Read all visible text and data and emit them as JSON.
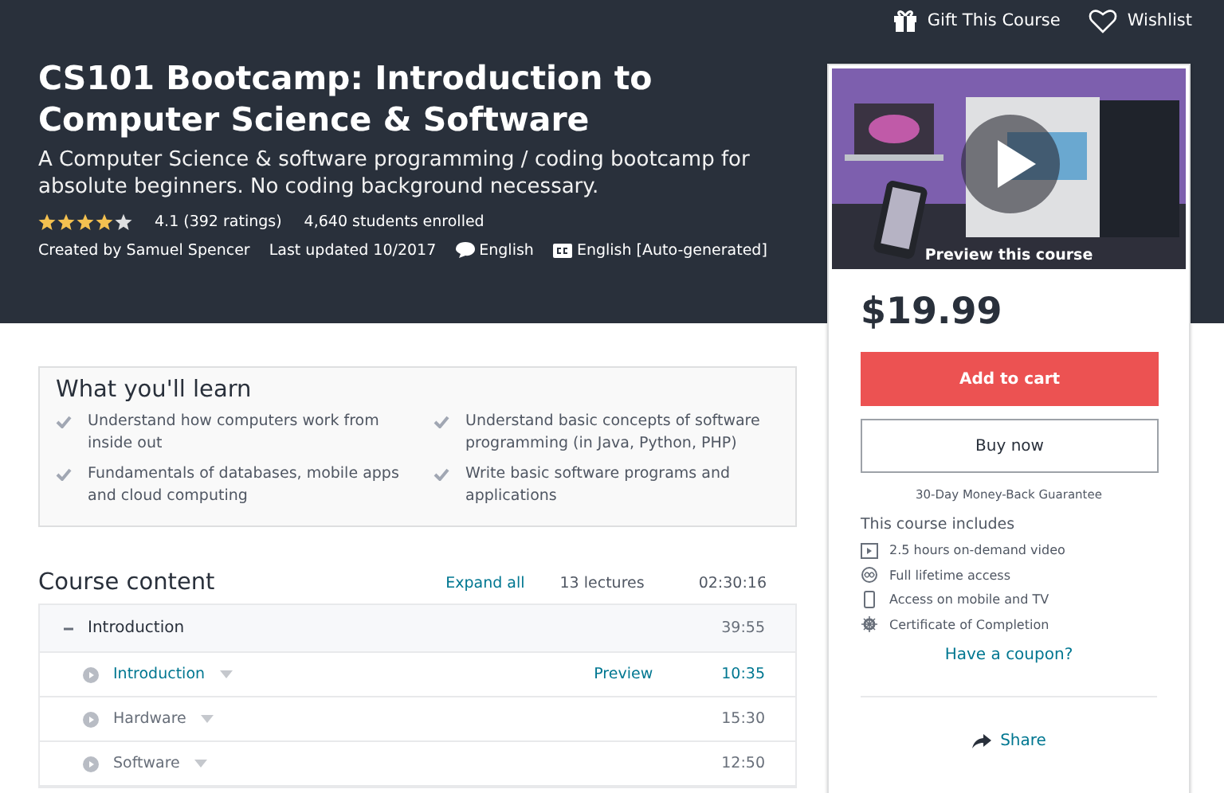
{
  "top_actions": [
    {
      "kind": "gift",
      "label": "Gift This Course"
    },
    {
      "kind": "heart",
      "label": "Wishlist"
    }
  ],
  "course": {
    "title": "CS101 Bootcamp: Introduction to Computer Science & Software",
    "subtitle": "A Computer Science & software programming / coding bootcamp for absolute beginners. No coding background necessary.",
    "stars": 4,
    "rating": "4.1 (392 ratings)",
    "enrolled": "4,640 students enrolled",
    "created_by": "Created by Samuel Spencer",
    "updated": "Last updated 10/2017",
    "language": "English",
    "captions": "English [Auto-generated]"
  },
  "learn": {
    "title": "What you'll learn",
    "items": [
      "Understand how computers work from inside out",
      "Understand basic concepts of software programming (in Java, Python, PHP)",
      "Fundamentals of databases, mobile apps and cloud computing",
      "Write basic software programs and applications"
    ]
  },
  "content": {
    "title": "Course content",
    "expand": "Expand all",
    "lectures": "13 lectures",
    "duration": "02:30:16",
    "sections": [
      {
        "title": "Introduction",
        "expanded": true,
        "duration": "39:55",
        "lectures": [
          {
            "title": "Introduction",
            "preview": "Preview",
            "duration": "10:35",
            "previewable": true
          },
          {
            "title": "Hardware",
            "duration": "15:30",
            "previewable": false
          },
          {
            "title": "Software",
            "duration": "12:50",
            "previewable": false
          }
        ]
      }
    ]
  },
  "sidebar": {
    "preview_label": "Preview this course",
    "price": "$19.99",
    "add_to_cart": "Add to cart",
    "buy_now": "Buy now",
    "guarantee": "30-Day Money-Back Guarantee",
    "includes_title": "This course includes",
    "includes": [
      {
        "kind": "video",
        "text": "2.5 hours on-demand video"
      },
      {
        "kind": "lifetime",
        "text": "Full lifetime access"
      },
      {
        "kind": "mobile",
        "text": "Access on mobile and TV"
      },
      {
        "kind": "certificate",
        "text": "Certificate of Completion"
      }
    ],
    "coupon": "Have a coupon?",
    "share": "Share"
  }
}
